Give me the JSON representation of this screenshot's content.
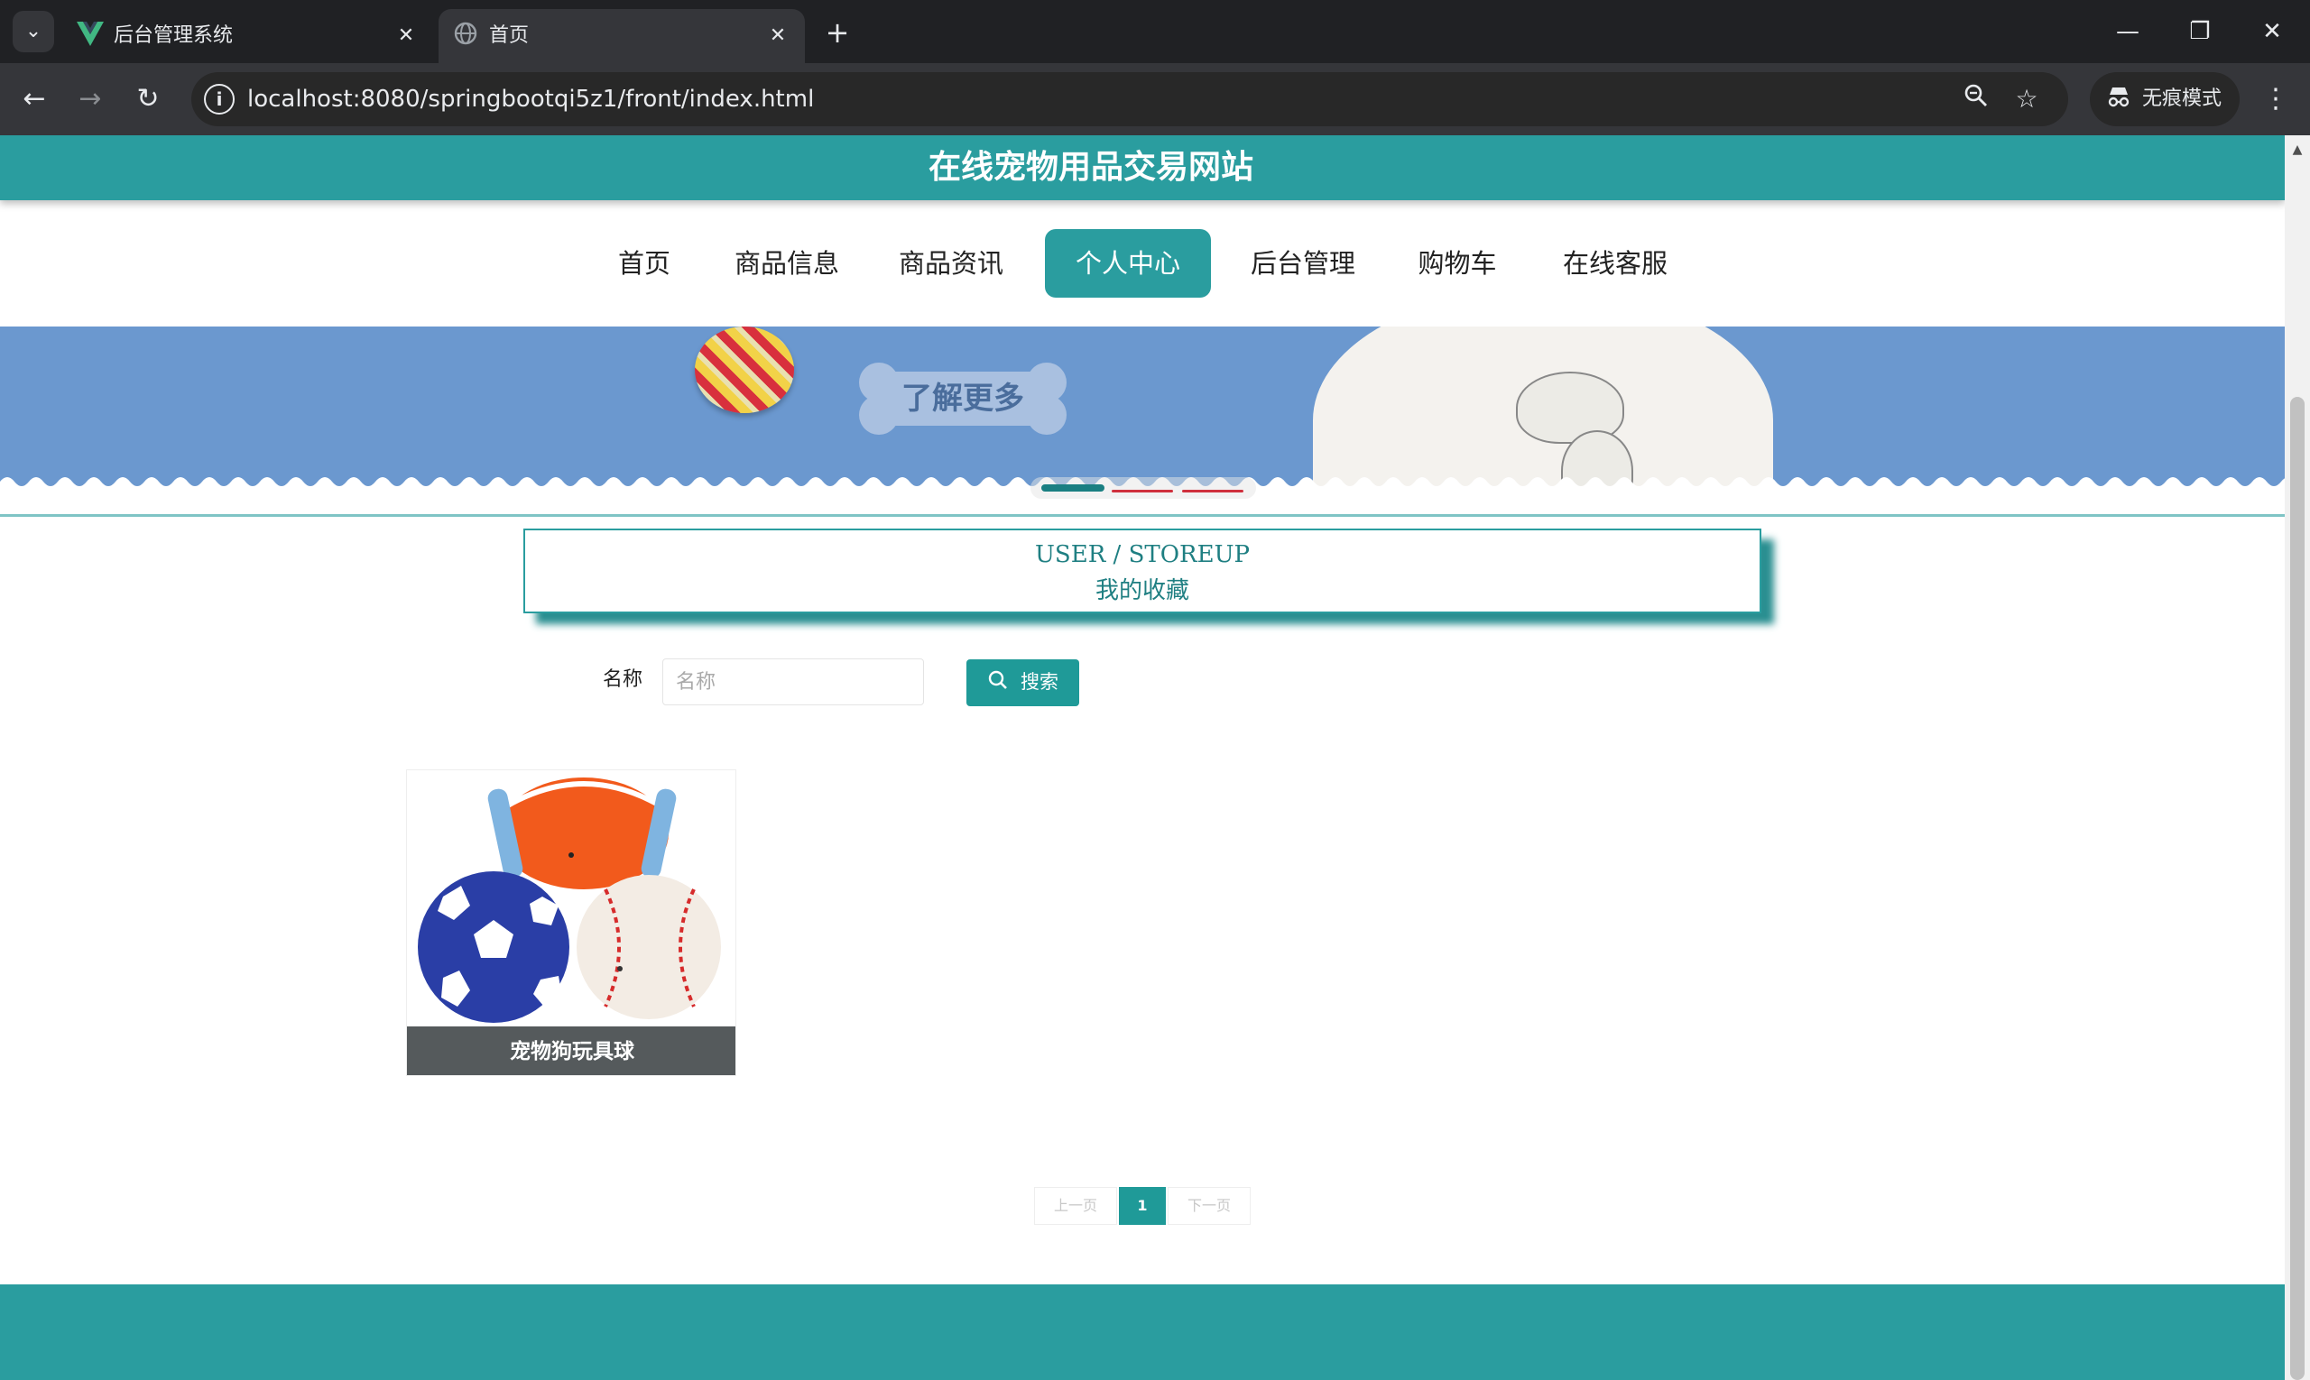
{
  "browser": {
    "tabs": [
      {
        "title": "后台管理系统",
        "favicon": "vue-logo-icon",
        "active": false
      },
      {
        "title": "首页",
        "favicon": "globe-icon",
        "active": true
      }
    ],
    "url": "localhost:8080/springbootqi5z1/front/index.html",
    "incognito_label": "无痕模式"
  },
  "site": {
    "title": "在线宠物用品交易网站",
    "nav": [
      {
        "label": "首页",
        "active": false
      },
      {
        "label": "商品信息",
        "active": false
      },
      {
        "label": "商品资讯",
        "active": false
      },
      {
        "label": "个人中心",
        "active": true
      },
      {
        "label": "后台管理",
        "active": false
      },
      {
        "label": "购物车",
        "active": false
      },
      {
        "label": "在线客服",
        "active": false
      }
    ],
    "banner": {
      "button_label": "了解更多",
      "slides": 3,
      "current_slide": 1
    }
  },
  "section": {
    "title_en": "USER / STOREUP",
    "title_cn": "我的收藏"
  },
  "search": {
    "label": "名称",
    "placeholder": "名称",
    "value": "",
    "button_label": "搜索"
  },
  "items": [
    {
      "name": "宠物狗玩具球"
    }
  ],
  "pagination": {
    "prev_label": "上一页",
    "next_label": "下一页",
    "current": "1"
  },
  "colors": {
    "primary": "#2a9d9f",
    "banner": "#6b98cf",
    "caption": "#555a5c"
  }
}
